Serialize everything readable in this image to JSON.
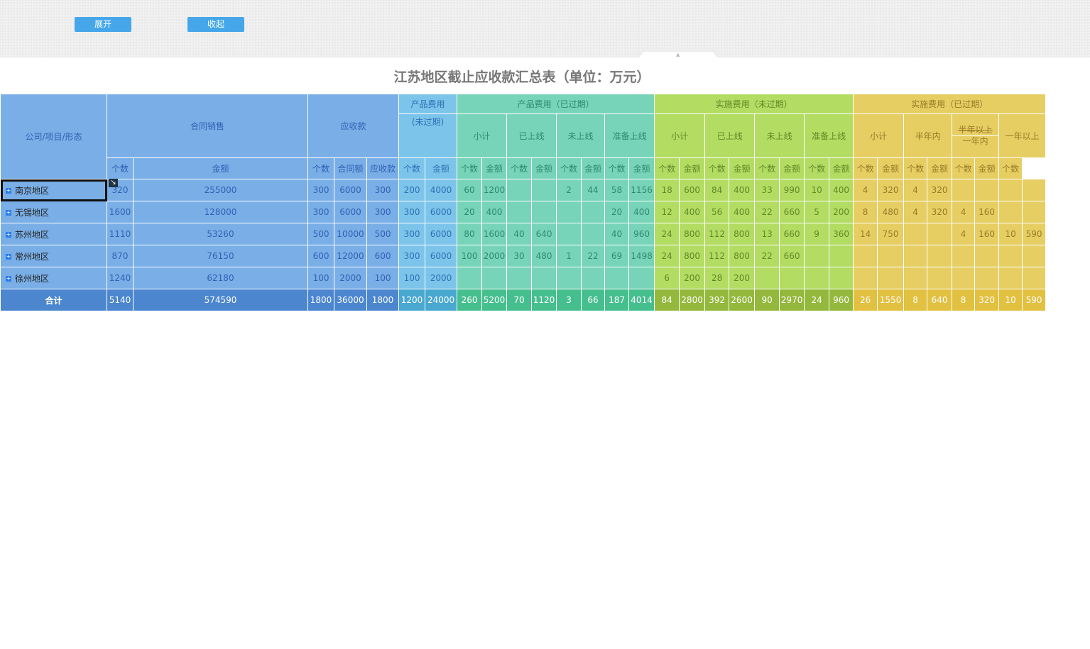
{
  "toolbar": {
    "expand_label": "展开",
    "collapse_label": "收起",
    "collapse_tab_icon": "▲"
  },
  "report": {
    "title": "江苏地区截止应收款汇总表（单位：万元）"
  },
  "colors": {
    "blue": "#79aee6",
    "light_blue": "#7cc4ea",
    "teal": "#78d4b8",
    "green": "#b3dc63",
    "yellow": "#e6ce63",
    "button": "#45a7ea"
  },
  "header": {
    "corner": "公司/项目/形态",
    "contract_sales": "合同销售",
    "receivable": "应收款",
    "product_fee": "产品费用",
    "product_fee_not_overdue": "(未过期)",
    "product_fee_overdue": "产品费用（已过期）",
    "impl_fee_not_overdue": "实施费用（未过期）",
    "impl_fee_overdue": "实施费用（已过期）",
    "sub_groups_status": [
      "小计",
      "已上线",
      "未上线",
      "准备上线"
    ],
    "sub_groups_age": [
      "小计",
      "半年内",
      "半年以上",
      "一年内",
      "一年以上"
    ],
    "count": "个数",
    "amount": "金额",
    "contract_amount": "合同额",
    "receivable_amount": "应收款"
  },
  "rows": [
    {
      "name": "南京地区",
      "values": [
        "320",
        "255000",
        "300",
        "6000",
        "300",
        "200",
        "4000",
        "60",
        "1200",
        "",
        "",
        "2",
        "44",
        "58",
        "1156",
        "18",
        "600",
        "84",
        "400",
        "33",
        "990",
        "10",
        "400",
        "4",
        "320",
        "4",
        "320",
        "",
        "",
        "",
        ""
      ]
    },
    {
      "name": "无锡地区",
      "values": [
        "1600",
        "128000",
        "300",
        "6000",
        "300",
        "300",
        "6000",
        "20",
        "400",
        "",
        "",
        "",
        "",
        "20",
        "400",
        "12",
        "400",
        "56",
        "400",
        "22",
        "660",
        "5",
        "200",
        "8",
        "480",
        "4",
        "320",
        "4",
        "160",
        "",
        ""
      ]
    },
    {
      "name": "苏州地区",
      "values": [
        "1110",
        "53260",
        "500",
        "10000",
        "500",
        "300",
        "6000",
        "80",
        "1600",
        "40",
        "640",
        "",
        "",
        "40",
        "960",
        "24",
        "800",
        "112",
        "800",
        "13",
        "660",
        "9",
        "360",
        "14",
        "750",
        "",
        "",
        "4",
        "160",
        "10",
        "590"
      ]
    },
    {
      "name": "常州地区",
      "values": [
        "870",
        "76150",
        "600",
        "12000",
        "600",
        "300",
        "6000",
        "100",
        "2000",
        "30",
        "480",
        "1",
        "22",
        "69",
        "1498",
        "24",
        "800",
        "112",
        "800",
        "22",
        "660",
        "",
        "",
        "",
        "",
        "",
        "",
        "",
        "",
        "",
        ""
      ]
    },
    {
      "name": "徐州地区",
      "values": [
        "1240",
        "62180",
        "100",
        "2000",
        "100",
        "100",
        "2000",
        "",
        "",
        "",
        "",
        "",
        "",
        "",
        "",
        "6",
        "200",
        "28",
        "200",
        "",
        "",
        "",
        "",
        "",
        "",
        "",
        "",
        "",
        "",
        "",
        ""
      ]
    }
  ],
  "total": {
    "name": "合计",
    "values": [
      "5140",
      "574590",
      "1800",
      "36000",
      "1800",
      "1200",
      "24000",
      "260",
      "5200",
      "70",
      "1120",
      "3",
      "66",
      "187",
      "4014",
      "84",
      "2800",
      "392",
      "2600",
      "90",
      "2970",
      "24",
      "960",
      "26",
      "1550",
      "8",
      "640",
      "8",
      "320",
      "10",
      "590"
    ]
  }
}
